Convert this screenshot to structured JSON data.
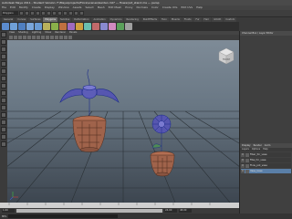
{
  "window": {
    "title": "Autodesk Maya 2011 - Student Version: F:\\Maya\\projects\\Flora\\scenes\\Garden.mb* --- flowerpot_stand.ma --- persp"
  },
  "menubar": {
    "items": [
      "File",
      "Edit",
      "Modify",
      "Create",
      "Display",
      "Window",
      "Assets",
      "Select",
      "Mesh",
      "Edit Mesh",
      "Proxy",
      "Normals",
      "Color",
      "Create UVs",
      "Edit UVs",
      "Help"
    ]
  },
  "statusline": {
    "mode": "Polygons"
  },
  "shelf": {
    "tabs": [
      "General",
      "Curves",
      "Surfaces",
      "Polygons",
      "Subdivs",
      "Deformation",
      "Animation",
      "Dynamics",
      "Rendering",
      "PaintEffects",
      "Toon",
      "Muscle",
      "Fluids",
      "Fur",
      "Hair",
      "nCloth",
      "Custom"
    ],
    "active_tab": "Polygons"
  },
  "panel": {
    "menu": [
      "View",
      "Shading",
      "Lighting",
      "Show",
      "Renderer",
      "Panels"
    ]
  },
  "viewcube": {
    "label": "FRONT"
  },
  "timeline": {
    "start": "1.00",
    "end": "24.00",
    "range_end": "48.00"
  },
  "command_line": {
    "label": "MEL"
  },
  "channel_box": {
    "tabs": [
      "Channel Box / Layer Editor"
    ]
  },
  "layers": {
    "tabs": [
      "Display",
      "Render",
      "Anim"
    ],
    "menu": [
      "Layers",
      "Options",
      "Help"
    ],
    "rows": [
      {
        "vis": "V",
        "name": "Fiber_for_vase"
      },
      {
        "vis": "V",
        "name": "Fibe_for_vase"
      },
      {
        "vis": "V",
        "name": "Flow_pot_vase"
      },
      {
        "vis": "V",
        "name": "Vase_base"
      }
    ],
    "selected_index": 3
  },
  "colors": {
    "viewport_top": "#7e8b97",
    "viewport_bottom": "#3d4650",
    "wire": "#1c2b8a",
    "pot": "#a0634b",
    "flower": "#5656b0"
  }
}
